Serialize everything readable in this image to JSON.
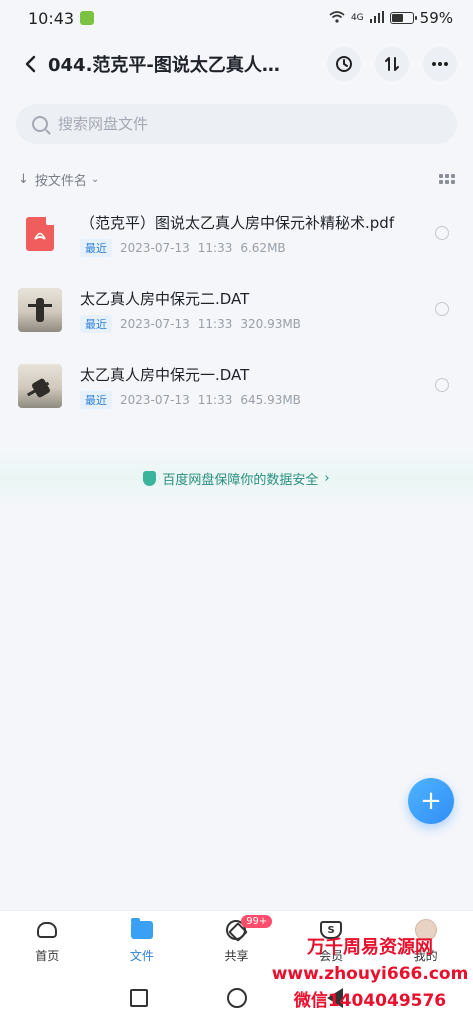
{
  "status_bar": {
    "time": "10:43",
    "network": "4G",
    "battery_text": "59%",
    "battery_level": 0.59
  },
  "header": {
    "title": "044.范克平-图说太乙真人房...",
    "back_icon": "back-arrow-icon",
    "actions": [
      "history-icon",
      "sort-transfer-icon",
      "more-icon"
    ]
  },
  "search": {
    "placeholder": "搜索网盘文件",
    "value": ""
  },
  "sort": {
    "label": "按文件名"
  },
  "files": [
    {
      "name": "（范克平）图说太乙真人房中保元补精秘术.pdf",
      "badge": "最近",
      "date": "2023-07-13",
      "time": "11:33",
      "size": "6.62MB",
      "type": "pdf"
    },
    {
      "name": "太乙真人房中保元二.DAT",
      "badge": "最近",
      "date": "2023-07-13",
      "time": "11:33",
      "size": "320.93MB",
      "type": "video"
    },
    {
      "name": "太乙真人房中保元一.DAT",
      "badge": "最近",
      "date": "2023-07-13",
      "time": "11:33",
      "size": "645.93MB",
      "type": "video"
    }
  ],
  "safety_banner": {
    "text": "百度网盘保障你的数据安全"
  },
  "fab": {
    "label": "+"
  },
  "bottom_nav": {
    "items": [
      {
        "label": "首页",
        "icon": "home-icon"
      },
      {
        "label": "文件",
        "icon": "folder-icon"
      },
      {
        "label": "共享",
        "icon": "share-icon",
        "badge": "99+"
      },
      {
        "label": "会员",
        "icon": "vip-icon"
      },
      {
        "label": "我的",
        "icon": "avatar-icon"
      }
    ]
  },
  "watermark": {
    "line1": "万千周易资源网",
    "line2": "www.zhouyi666.com",
    "line3": "微信1404049576"
  },
  "colors": {
    "accent": "#2f7fd8",
    "background": "#f4f6fa",
    "pdf": "#f05d5d",
    "watermark": "#e8102d"
  }
}
